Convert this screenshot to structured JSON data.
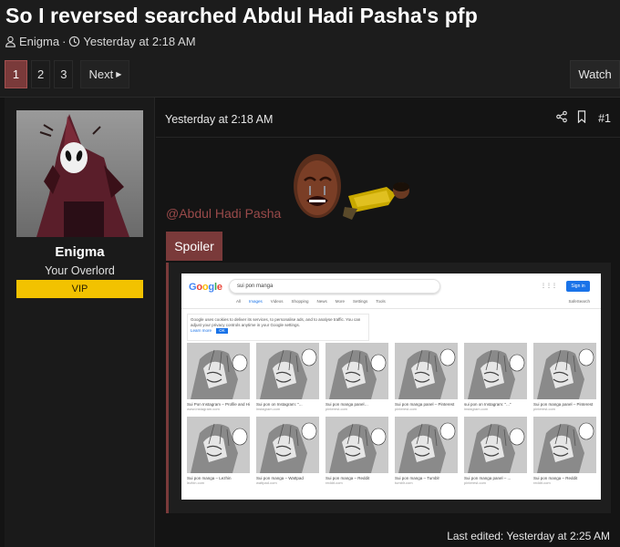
{
  "thread": {
    "title": "So I reversed searched Abdul Hadi Pasha's pfp",
    "author": "Enigma",
    "date": "Yesterday at 2:18 AM"
  },
  "pagination": {
    "pages": [
      "1",
      "2",
      "3"
    ],
    "current": "1",
    "next_label": "Next"
  },
  "watch_label": "Watch",
  "user": {
    "name": "Enigma",
    "title": "Your Overlord",
    "badge": "VIP",
    "badge_color": "#f2c200"
  },
  "post": {
    "date": "Yesterday at 2:18 AM",
    "number": "#1",
    "mention": "@Abdul Hadi Pasha",
    "spoiler_label": "Spoiler",
    "last_edited": "Last edited: Yesterday at 2:25 AM"
  },
  "embedded_screenshot": {
    "logo": "Google",
    "query": "sui pon manga",
    "signin": "Sign in",
    "tabs": [
      "All",
      "Images",
      "Videos",
      "Shopping",
      "News",
      "More",
      "Settings",
      "Tools"
    ],
    "safe_search": "SafeSearch",
    "notice": "Google uses cookies to deliver its services, to personalise ads, and to analyse traffic. You can adjust your privacy controls anytime in your Google settings.",
    "notice_learn": "Learn more",
    "notice_ok": "OK",
    "results": [
      {
        "caption": "Sui Pon Instagram – Profile and Hi…",
        "source": "www.instagram.com"
      },
      {
        "caption": "Sui pon on Instagram: \"...",
        "source": "instagram.com"
      },
      {
        "caption": "Sui pon manga panel…",
        "source": "pinterest.com"
      },
      {
        "caption": "Sui pon manga panel – Pinterest",
        "source": "pinterest.com"
      },
      {
        "caption": "sui pon on Instagram: \"...\"",
        "source": "instagram.com"
      },
      {
        "caption": "Sui pon manga panel – Pinterest",
        "source": "pinterest.com"
      },
      {
        "caption": "Sui pon manga – Lezhin",
        "source": "lezhin.com"
      },
      {
        "caption": "Sui pon manga – Wattpad",
        "source": "wattpad.com"
      },
      {
        "caption": "Sui pon manga – Reddit",
        "source": "reddit.com"
      },
      {
        "caption": "Sui pon manga – Tumblr",
        "source": "tumblr.com"
      },
      {
        "caption": "Sui pon manga panel – ...",
        "source": "pinterest.com"
      },
      {
        "caption": "Sui pon manga – Reddit",
        "source": "reddit.com"
      }
    ]
  },
  "colors": {
    "accent": "#7a3a3a",
    "mention": "#9a4a4a",
    "background": "#1c1c1c"
  }
}
